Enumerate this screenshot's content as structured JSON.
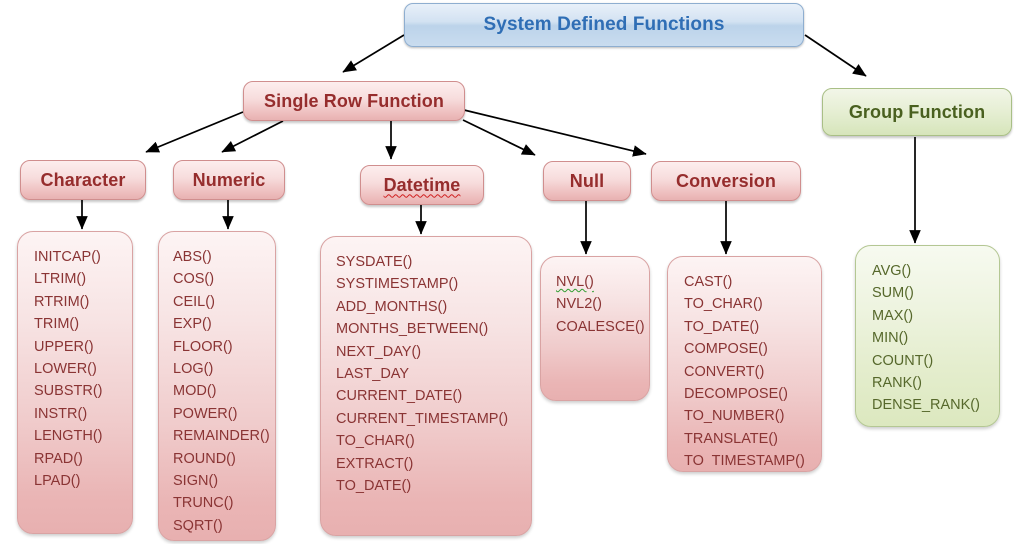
{
  "diagram": {
    "title": "System Defined Functions",
    "colors": {
      "root_fill": "#cfe0f0",
      "root_text": "#2f6eb5",
      "pink_fill": "#f0cccc",
      "pink_text": "#962d2d",
      "pink_list_text": "#8a3434",
      "green_fill": "#e0ebc8",
      "green_text": "#49601f",
      "green_list_text": "#56682b",
      "connector": "#000000"
    },
    "root": {
      "label": "System Defined Functions"
    },
    "level2": [
      {
        "id": "single-row-function",
        "label": "Single Row Function"
      },
      {
        "id": "group-function",
        "label": "Group Function"
      }
    ],
    "categories": [
      {
        "id": "character",
        "label": "Character",
        "spellcheck": false,
        "items": [
          "INITCAP()",
          "LTRIM()",
          "RTRIM()",
          "TRIM()",
          "UPPER()",
          "LOWER()",
          "SUBSTR()",
          "INSTR()",
          "LENGTH()",
          "RPAD()",
          "LPAD()"
        ]
      },
      {
        "id": "numeric",
        "label": "Numeric",
        "spellcheck": false,
        "items": [
          "ABS()",
          "COS()",
          "CEIL()",
          "EXP()",
          "FLOOR()",
          "LOG()",
          "MOD()",
          "POWER()",
          "REMAINDER()",
          "ROUND()",
          "SIGN()",
          "TRUNC()",
          "SQRT()"
        ]
      },
      {
        "id": "datetime",
        "label": "Datetime",
        "spellcheck": "red",
        "items": [
          "SYSDATE()",
          "SYSTIMESTAMP()",
          "ADD_MONTHS()",
          "MONTHS_BETWEEN()",
          "NEXT_DAY()",
          "LAST_DAY",
          "CURRENT_DATE()",
          "CURRENT_TIMESTAMP()",
          "TO_CHAR()",
          "EXTRACT()",
          "TO_DATE()"
        ]
      },
      {
        "id": "null",
        "label": "Null",
        "spellcheck": false,
        "items": [
          "NVL()",
          "NVL2()",
          "COALESCE()"
        ],
        "item_marks": {
          "0": "green"
        }
      },
      {
        "id": "conversion",
        "label": "Conversion",
        "spellcheck": false,
        "items": [
          "CAST()",
          "TO_CHAR()",
          "TO_DATE()",
          "COMPOSE()",
          "CONVERT()",
          "DECOMPOSE()",
          "TO_NUMBER()",
          "TRANSLATE()",
          "TO  TIMESTAMP()"
        ]
      },
      {
        "id": "group",
        "label": "Group Function",
        "spellcheck": false,
        "items": [
          "AVG()",
          "SUM()",
          "MAX()",
          "MIN()",
          "COUNT()",
          "RANK()",
          "DENSE_RANK()"
        ]
      }
    ]
  }
}
